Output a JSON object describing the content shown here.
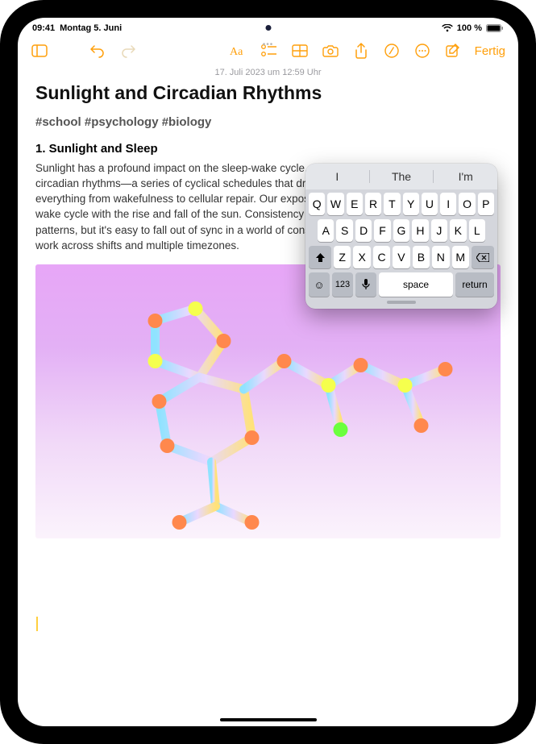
{
  "status": {
    "time": "09:41",
    "date": "Montag 5. Juni",
    "battery_pct": "100 %"
  },
  "toolbar": {
    "done_label": "Fertig"
  },
  "note": {
    "timestamp": "17. Juli 2023 um 12:59 Uhr",
    "title": "Sunlight and Circadian Rhythms",
    "tags": "#school #psychology #biology",
    "section_heading": "1. Sunlight and Sleep",
    "paragraph": "Sunlight has a profound impact on the sleep-wake cycle, which is the most important of our circadian rhythms—a series of cyclical schedules that drive our bodies' functions to optimize everything from wakefulness to cellular repair. Our exposure to sunlight helps link our sleep-wake cycle with the rise and fall of the sun. Consistency is key to developing healthy sleep patterns, but it's easy to fall out of sync in a world of constant connection, where many of us work across shifts and multiple timezones."
  },
  "keyboard": {
    "suggestions": [
      "I",
      "The",
      "I'm"
    ],
    "rows": {
      "r1": [
        "Q",
        "W",
        "E",
        "R",
        "T",
        "Y",
        "U",
        "I",
        "O",
        "P"
      ],
      "r2": [
        "A",
        "S",
        "D",
        "F",
        "G",
        "H",
        "J",
        "K",
        "L"
      ],
      "r3": [
        "Z",
        "X",
        "C",
        "V",
        "B",
        "N",
        "M"
      ]
    },
    "num_label": "123",
    "space_label": "space",
    "return_label": "return"
  }
}
